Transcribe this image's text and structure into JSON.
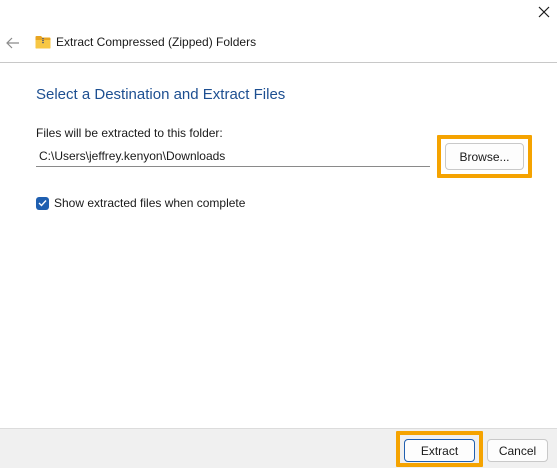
{
  "window": {
    "title": "Extract Compressed (Zipped) Folders"
  },
  "page": {
    "heading": "Select a Destination and Extract Files",
    "destination_label": "Files will be extracted to this folder:",
    "destination_path": "C:\\Users\\jeffrey.kenyon\\Downloads",
    "browse_label": "Browse...",
    "show_files_label": "Show extracted files when complete",
    "show_files_checked": true
  },
  "footer": {
    "extract_label": "Extract",
    "cancel_label": "Cancel"
  },
  "icons": {
    "close": "close-icon",
    "back": "back-arrow-icon",
    "title": "zip-folder-icon",
    "checkbox": "checkmark-icon"
  },
  "colors": {
    "heading": "#1d4f91",
    "accent": "#1f5fb0",
    "highlight": "#f5a300",
    "footer_bg": "#f0f0f0"
  }
}
